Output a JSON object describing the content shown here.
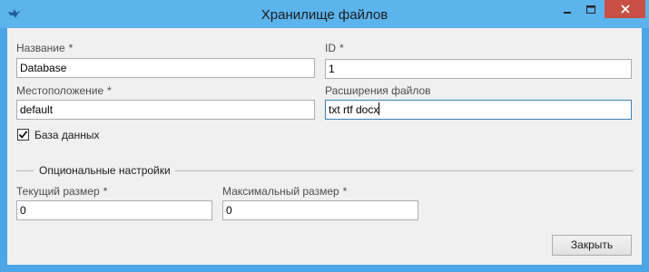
{
  "window": {
    "title": "Хранилище файлов",
    "app_icon": "bird-icon",
    "controls": [
      "minimize-icon",
      "maximize-icon",
      "close-icon"
    ]
  },
  "form": {
    "name": {
      "label": "Название",
      "required_mark": "*",
      "value": "Database"
    },
    "id": {
      "label": "ID",
      "required_mark": "*",
      "value": "1"
    },
    "location": {
      "label": "Местоположение",
      "required_mark": "*",
      "value": "default"
    },
    "extensions": {
      "label": "Расширения файлов",
      "value": "txt rtf docx"
    },
    "is_database": {
      "label": "База данных",
      "checked": true
    },
    "optional_group": {
      "title": "Опциональные настройки",
      "current_size": {
        "label": "Текущий размер",
        "required_mark": "*",
        "value": "0"
      },
      "max_size": {
        "label": "Максимальный размер",
        "required_mark": "*",
        "value": "0"
      }
    }
  },
  "buttons": {
    "close": "Закрыть"
  },
  "colors": {
    "titlebar": "#5cb4ec",
    "close_button": "#c74f44",
    "client_bg": "#f0f0f0",
    "focus_border": "#3c7fb1"
  }
}
